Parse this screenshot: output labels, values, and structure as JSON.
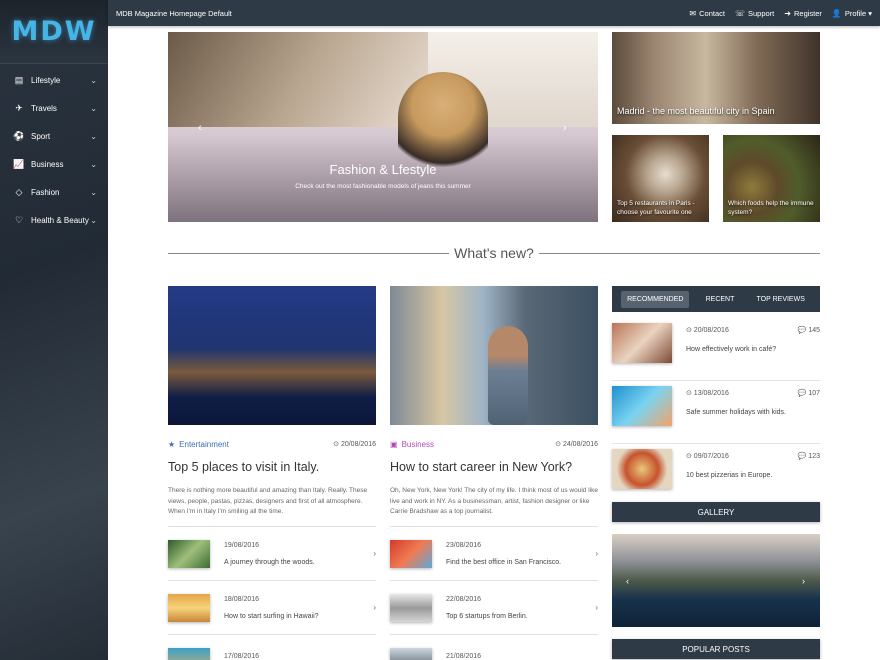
{
  "brand": {
    "logo": "MDW"
  },
  "topbar": {
    "title": "MDB Magazine Homepage Default",
    "links": [
      {
        "label": "Contact",
        "icon": "✉"
      },
      {
        "label": "Support",
        "icon": "☏"
      },
      {
        "label": "Register",
        "icon": "➜"
      },
      {
        "label": "Profile ▾",
        "icon": "👤"
      }
    ]
  },
  "sidebar": {
    "items": [
      {
        "label": "Lifestyle",
        "icon": "▤"
      },
      {
        "label": "Travels",
        "icon": "✈"
      },
      {
        "label": "Sport",
        "icon": "⚽"
      },
      {
        "label": "Business",
        "icon": "📈"
      },
      {
        "label": "Fashion",
        "icon": "◇"
      },
      {
        "label": "Health & Beauty",
        "icon": "♡"
      }
    ]
  },
  "hero": {
    "title": "Fashion & Lfestyle",
    "subtitle": "Check out the most fashionable models of jeans this summer",
    "slides": 3,
    "active_slide": 2
  },
  "tiles": {
    "madrid": "Madrid - the most beautiful city in Spain",
    "paris": "Top 5 restaurants in Paris - choose your favourite one",
    "food": "Which foods help the immune system?"
  },
  "section": {
    "heading": "What's new?"
  },
  "articles": [
    {
      "category": "Entertainment",
      "category_icon": "★",
      "date": "⊙ 20/08/2016",
      "title": "Top 5 places to visit in Italy.",
      "text": "There is nothing more beautiful and amazing than Italy. Really. These views, people, pastas, pizzas, designers and first of all atmosphere. When I'm in Italy I'm smiling all the time.",
      "list": [
        {
          "date": "19/08/2016",
          "title": "A journey through the woods."
        },
        {
          "date": "18/08/2016",
          "title": "How to start surfing in Hawaii?"
        },
        {
          "date": "17/08/2016",
          "title": ""
        }
      ]
    },
    {
      "category": "Business",
      "category_icon": "▣",
      "date": "⊙ 24/08/2016",
      "title": "How to start career in New York?",
      "text": "Oh, New York, New York! The city of my life. I think most of us would like live and work in NY. As a businessman, artist, fashion designer or like Carrie Bradshaw as a top journalist.",
      "list": [
        {
          "date": "23/08/2016",
          "title": "Find the best office in San Francisco."
        },
        {
          "date": "22/08/2016",
          "title": "Top 6 startups from Berlin."
        },
        {
          "date": "21/08/2016",
          "title": ""
        }
      ]
    }
  ],
  "tabs": {
    "recommended": "RECOMMENDED",
    "recent": "RECENT",
    "top_reviews": "TOP REVIEWS"
  },
  "recommended": [
    {
      "date": "⊙ 20/08/2016",
      "comments": "💬 145",
      "title": "How effectively work in café?"
    },
    {
      "date": "⊙ 13/08/2016",
      "comments": "💬 107",
      "title": "Safe summer holidays with kids."
    },
    {
      "date": "⊙ 09/07/2016",
      "comments": "💬 123",
      "title": "10 best pizzerias in Europe."
    }
  ],
  "gallery": {
    "label": "GALLERY"
  },
  "popular": {
    "label": "POPULAR POSTS"
  },
  "controls": {
    "prev": "‹",
    "next": "›",
    "chevron": "⌄"
  },
  "colors": {
    "sidebar": "#2a3440",
    "topbar": "#2e3b46",
    "accent_entertainment": "#3c6fb4",
    "accent_business": "#b04ab8"
  }
}
